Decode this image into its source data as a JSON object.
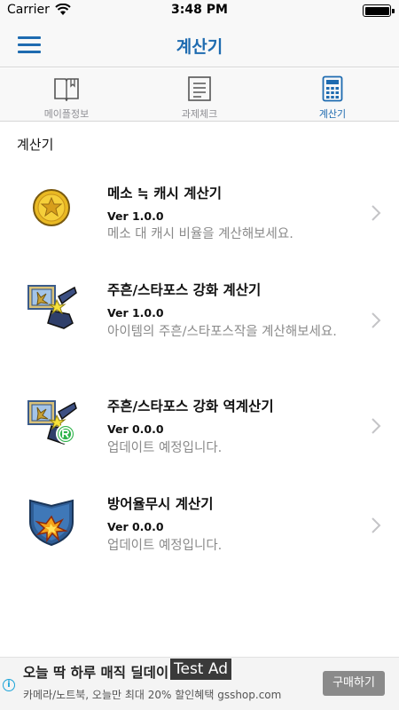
{
  "status_bar": {
    "carrier": "Carrier",
    "time": "3:48 PM",
    "wifi_icon": "wifi-icon",
    "battery_icon": "battery-icon"
  },
  "nav": {
    "title": "계산기",
    "menu_icon": "hamburger-menu-icon"
  },
  "tabs": [
    {
      "label": "메이플정보",
      "icon": "book-icon",
      "active": false
    },
    {
      "label": "과제체크",
      "icon": "checklist-icon",
      "active": false
    },
    {
      "label": "계산기",
      "icon": "calculator-icon",
      "active": true
    }
  ],
  "section_title": "계산기",
  "items": [
    {
      "title": "메소 ≒ 캐시 계산기",
      "version": "Ver 1.0.0",
      "description": "메소 대 캐시 비율을 계산해보세요.",
      "icon": "meso-coin-icon"
    },
    {
      "title": "주흔/스타포스 강화 계산기",
      "version": "Ver 1.0.0",
      "description": "아이템의 주흔/스타포스작을 계산해보세요.",
      "icon": "scroll-hammer-icon"
    },
    {
      "title": "주흔/스타포스 강화 역계산기",
      "version": "Ver 0.0.0",
      "description": "업데이트 예정입니다.",
      "icon": "scroll-hammer-reverse-icon"
    },
    {
      "title": "방어율무시 계산기",
      "version": "Ver 0.0.0",
      "description": "업데이트 예정입니다.",
      "icon": "shield-break-icon"
    }
  ],
  "ad": {
    "title": "오늘 딱 하루 매직 딜데이",
    "subtitle": "카메라/노트북, 오늘만 최대 20% 할인혜택 gsshop.com",
    "test_label": "Test Ad",
    "button_label": "구매하기",
    "info_icon": "i"
  },
  "colors": {
    "accent": "#1e6bb0",
    "muted_text": "#8a8a8a",
    "bar_background": "#f8f8f8"
  }
}
